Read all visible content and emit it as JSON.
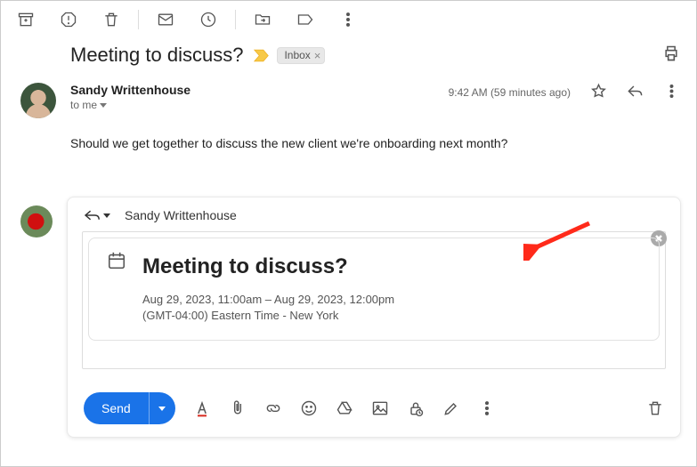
{
  "subject": "Meeting to discuss?",
  "inbox_chip": "Inbox",
  "sender_name": "Sandy Writtenhouse",
  "to_text": "to me",
  "timestamp": "9:42 AM (59 minutes ago)",
  "message_body": "Should we get together to discuss the new client we're onboarding next month?",
  "reply_to_name": "Sandy Writtenhouse",
  "event": {
    "title": "Meeting to discuss?",
    "time_line": "Aug 29, 2023, 11:00am – Aug 29, 2023, 12:00pm",
    "tz_line": "(GMT-04:00) Eastern Time - New York"
  },
  "send_label": "Send"
}
